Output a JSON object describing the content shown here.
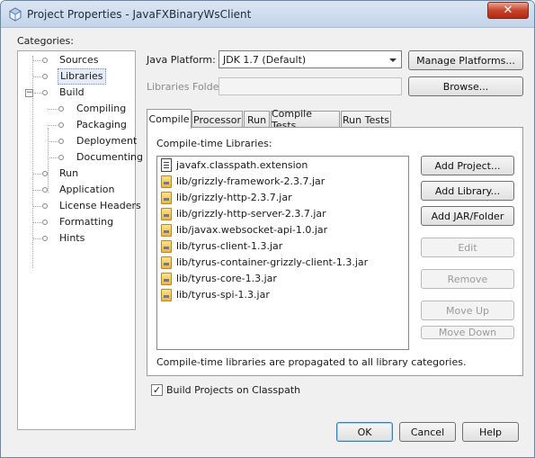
{
  "window": {
    "title": "Project Properties - JavaFXBinaryWsClient",
    "close_glyph": "✕"
  },
  "categories": {
    "label": "Categories:",
    "items": [
      {
        "label": "Sources"
      },
      {
        "label": "Libraries",
        "selected": true
      },
      {
        "label": "Build",
        "expanded": true,
        "children": [
          {
            "label": "Compiling"
          },
          {
            "label": "Packaging"
          },
          {
            "label": "Deployment"
          },
          {
            "label": "Documenting"
          }
        ]
      },
      {
        "label": "Run"
      },
      {
        "label": "Application"
      },
      {
        "label": "License Headers"
      },
      {
        "label": "Formatting"
      },
      {
        "label": "Hints"
      }
    ],
    "collapse_glyph": "−"
  },
  "platform": {
    "label": "Java Platform:",
    "value": "JDK 1.7 (Default)",
    "manage_button": "Manage Platforms..."
  },
  "libraries_folder": {
    "label": "Libraries Folder:",
    "value": "",
    "browse_button": "Browse..."
  },
  "tabs": [
    {
      "label": "Compile",
      "active": true
    },
    {
      "label": "Processor"
    },
    {
      "label": "Run"
    },
    {
      "label": "Compile Tests"
    },
    {
      "label": "Run Tests"
    }
  ],
  "compile": {
    "list_label": "Compile-time Libraries:",
    "libraries": [
      {
        "name": "javafx.classpath.extension",
        "icon": "classpath-icon"
      },
      {
        "name": "lib/grizzly-framework-2.3.7.jar",
        "icon": "jar-icon"
      },
      {
        "name": "lib/grizzly-http-2.3.7.jar",
        "icon": "jar-icon"
      },
      {
        "name": "lib/grizzly-http-server-2.3.7.jar",
        "icon": "jar-icon"
      },
      {
        "name": "lib/javax.websocket-api-1.0.jar",
        "icon": "jar-icon"
      },
      {
        "name": "lib/tyrus-client-1.3.jar",
        "icon": "jar-icon"
      },
      {
        "name": "lib/tyrus-container-grizzly-client-1.3.jar",
        "icon": "jar-icon"
      },
      {
        "name": "lib/tyrus-core-1.3.jar",
        "icon": "jar-icon"
      },
      {
        "name": "lib/tyrus-spi-1.3.jar",
        "icon": "jar-icon"
      }
    ],
    "buttons": {
      "add_project": "Add Project...",
      "add_library": "Add Library...",
      "add_jar": "Add JAR/Folder",
      "edit": "Edit",
      "remove": "Remove",
      "move_up": "Move Up",
      "move_down": "Move Down"
    },
    "note": "Compile-time libraries are propagated to all library categories."
  },
  "build_on_classpath": {
    "label": "Build Projects on Classpath",
    "checked": true,
    "check_glyph": "✓"
  },
  "footer": {
    "ok": "OK",
    "cancel": "Cancel",
    "help": "Help"
  }
}
